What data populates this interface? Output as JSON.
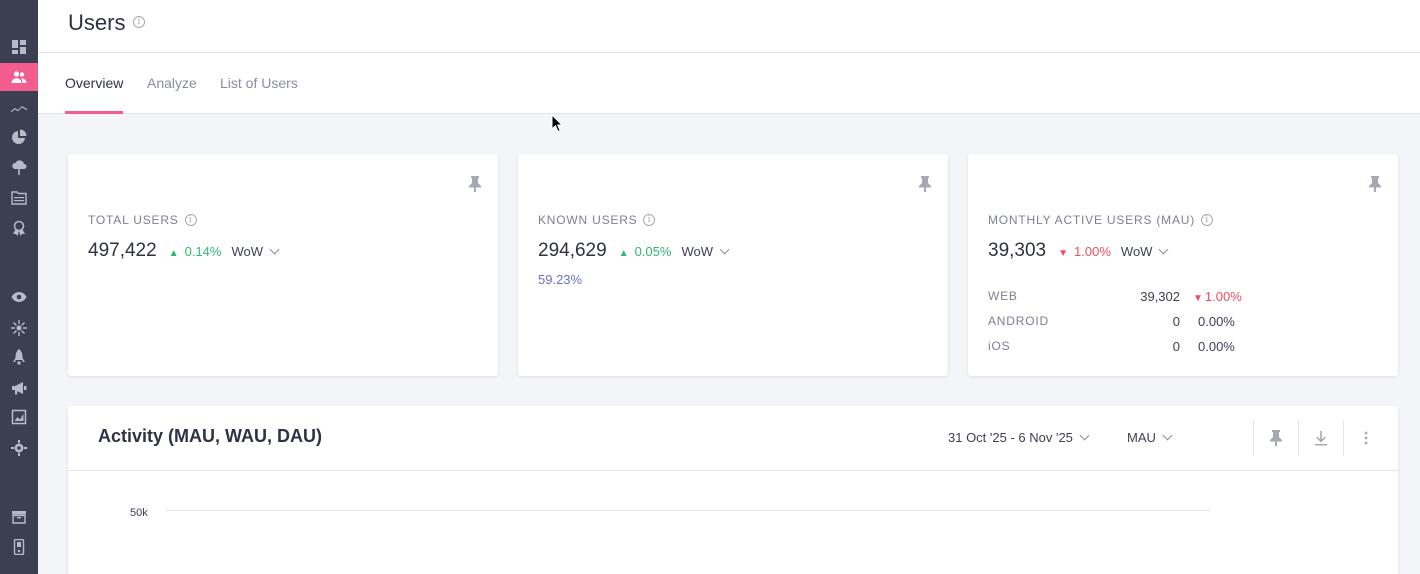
{
  "sidebar": {
    "items": [
      {
        "icon": "dashboard-icon"
      },
      {
        "icon": "users-icon",
        "active": true
      },
      {
        "icon": "trend-icon"
      },
      {
        "icon": "pie-chart-icon"
      },
      {
        "icon": "cloud-upload-icon"
      },
      {
        "icon": "folder-icon"
      },
      {
        "icon": "badge-icon"
      },
      {
        "icon": "eye-icon"
      },
      {
        "icon": "sparkle-icon"
      },
      {
        "icon": "rocket-icon"
      },
      {
        "icon": "megaphone-icon"
      },
      {
        "icon": "report-icon"
      },
      {
        "icon": "settings-icon"
      },
      {
        "icon": "archive-icon"
      },
      {
        "icon": "device-icon"
      }
    ]
  },
  "header": {
    "title": "Users",
    "info_icon": "info-icon"
  },
  "tabs": [
    {
      "label": "Overview",
      "active": true
    },
    {
      "label": "Analyze"
    },
    {
      "label": "List of Users"
    }
  ],
  "cards": {
    "total": {
      "label": "TOTAL USERS",
      "value": "497,422",
      "delta": "0.14%",
      "trend": "up",
      "period": "WoW"
    },
    "known": {
      "label": "KNOWN USERS",
      "value": "294,629",
      "delta": "0.05%",
      "trend": "up",
      "period": "WoW",
      "share": "59.23%"
    },
    "mau": {
      "label": "MONTHLY ACTIVE USERS (MAU)",
      "value": "39,303",
      "delta": "1.00%",
      "trend": "down",
      "period": "WoW",
      "platforms": [
        {
          "name": "WEB",
          "value": "39,302",
          "pct": "1.00%",
          "trend": "down"
        },
        {
          "name": "ANDROID",
          "value": "0",
          "pct": "0.00%"
        },
        {
          "name": "iOS",
          "value": "0",
          "pct": "0.00%"
        }
      ]
    }
  },
  "activity": {
    "title": "Activity (MAU, WAU, DAU)",
    "date_range": "31 Oct '25 - 6 Nov '25",
    "metric": "MAU",
    "y_tick": "50k"
  },
  "colors": {
    "accent": "#f25c8e",
    "sidebar": "#3c3f52",
    "up": "#2eb872",
    "down": "#ef4d5b",
    "link": "#6c6fd6"
  }
}
